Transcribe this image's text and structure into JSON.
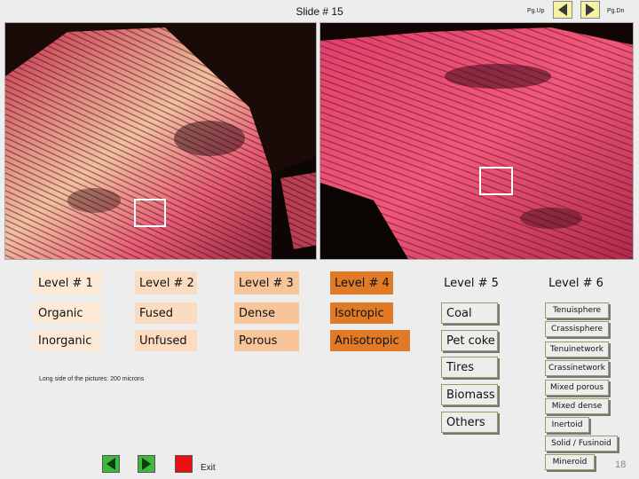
{
  "header": {
    "slide_title": "Slide # 15",
    "pg_up_label": "Pg.Up",
    "pg_dn_label": "Pg.Dn"
  },
  "levels": {
    "level1": {
      "header": "Level # 1",
      "items": [
        "Organic",
        "Inorganic"
      ]
    },
    "level2": {
      "header": "Level # 2",
      "items": [
        "Fused",
        "Unfused"
      ]
    },
    "level3": {
      "header": "Level # 3",
      "items": [
        "Dense",
        "Porous"
      ]
    },
    "level4": {
      "header": "Level # 4",
      "items": [
        "Isotropic",
        "Anisotropic"
      ]
    },
    "level5": {
      "header": "Level # 5",
      "items": [
        "Coal",
        "Pet coke",
        "Tires",
        "Biomass",
        "Others"
      ]
    },
    "level6": {
      "header": "Level # 6",
      "items": [
        "Tenuisphere",
        "Crassisphere",
        "Tenuinetwork",
        "Crassinetwork",
        "Mixed porous",
        "Mixed dense",
        "Inertoid",
        "Solid / Fusinoid",
        "Mineroid"
      ]
    }
  },
  "footnote": "Long side of the pictures: 200 microns",
  "footer": {
    "exit_label": "Exit",
    "page_number": "18"
  },
  "colors": {
    "level1": "#fde9d6",
    "level2": "#fbdcc0",
    "level3": "#f8c49a",
    "level4": "#e07a26",
    "nav_green": "#3fb83f",
    "exit_red": "#e81010"
  }
}
